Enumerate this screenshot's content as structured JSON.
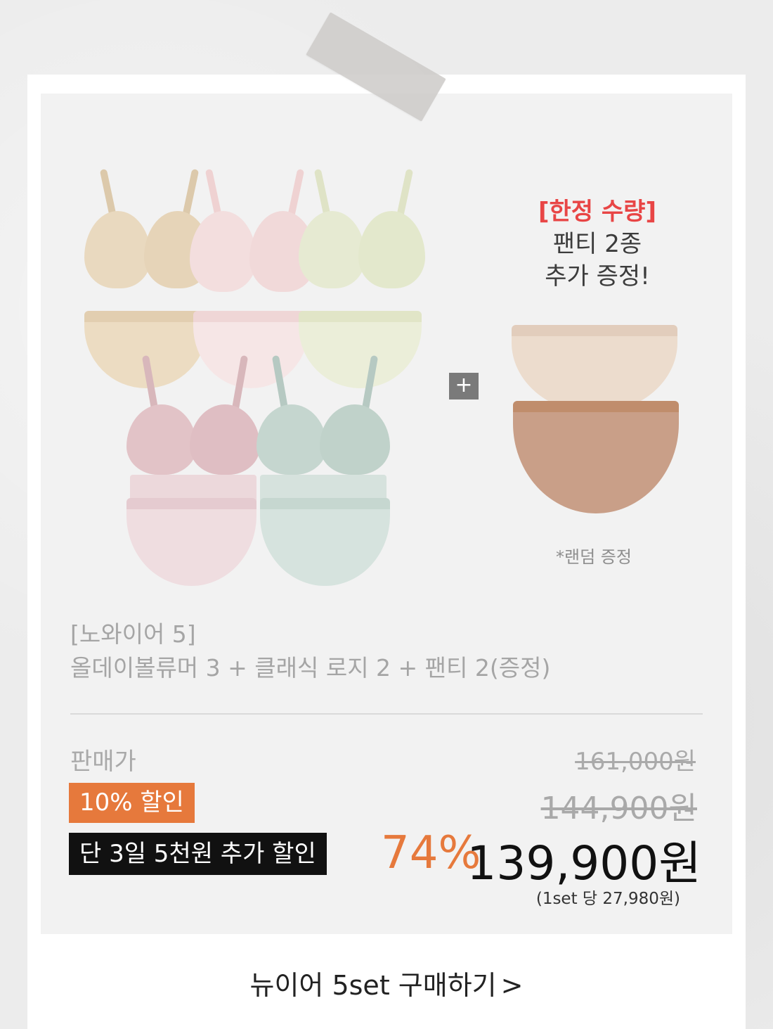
{
  "gift": {
    "limited_label": "[한정 수량]",
    "line1": "팬티 2종",
    "line2": "추가 증정!",
    "note": "*랜덤 증정"
  },
  "plus_symbol": "+",
  "product": {
    "title_line1": "[노와이어 5]",
    "title_line2": "올데이볼류머 3 + 클래식 로지 2 + 팬티 2(증정)"
  },
  "pricing": {
    "label": "판매가",
    "original_price": "161,000원",
    "discount_badge": "10% 할인",
    "discounted_price": "144,900원",
    "extra_badge": "단 3일 5천원 추가 할인",
    "discount_percent": "74%",
    "final_price": "139,900원",
    "per_set": "(1set 당 27,980원)"
  },
  "cta": {
    "label": "뉴이어 5set 구매하기",
    "chevron": ">"
  },
  "colors": {
    "accent_orange": "#e6793c",
    "accent_red": "#e84545",
    "bra_beige": "#e9d9bf",
    "bra_pink": "#f3dede",
    "bra_green": "#e6ead2",
    "lace_pink": "#e2c3c7",
    "lace_green": "#c5d6cf",
    "gift_panty_light": "#e7d7c9",
    "gift_panty_tan": "#c79a82"
  }
}
